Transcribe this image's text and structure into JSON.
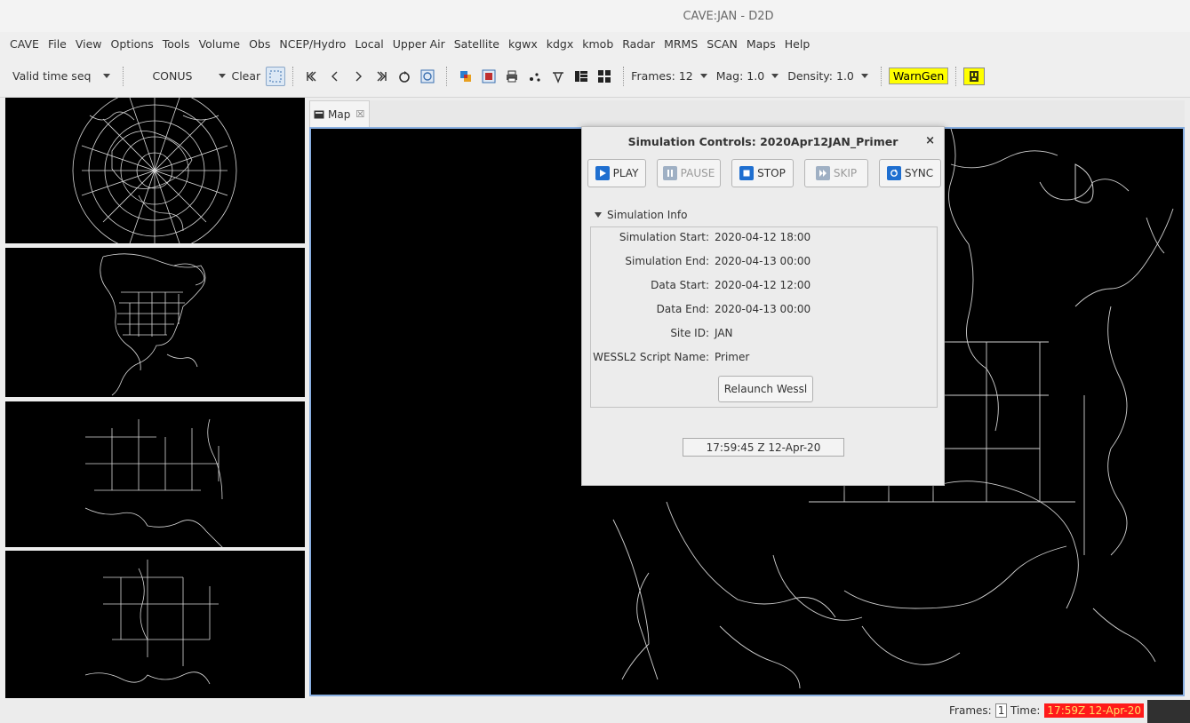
{
  "window": {
    "title": "CAVE:JAN - D2D"
  },
  "menu": [
    "CAVE",
    "File",
    "View",
    "Options",
    "Tools",
    "Volume",
    "Obs",
    "NCEP/Hydro",
    "Local",
    "Upper Air",
    "Satellite",
    "kgwx",
    "kdgx",
    "kmob",
    "Radar",
    "MRMS",
    "SCAN",
    "Maps",
    "Help"
  ],
  "toolbar": {
    "time_mode": "Valid time seq",
    "scale": "CONUS",
    "clear_label": "Clear",
    "frames": "Frames: 12",
    "mag": "Mag: 1.0",
    "density": "Density: 1.0",
    "warngen": "WarnGen"
  },
  "tabs": [
    {
      "label": "Map",
      "close": "☒"
    }
  ],
  "dialog": {
    "title": "Simulation Controls: 2020Apr12JAN_Primer",
    "close": "×",
    "buttons": {
      "play": "PLAY",
      "pause": "PAUSE",
      "stop": "STOP",
      "skip": "SKIP",
      "sync": "SYNC"
    },
    "section": "Simulation Info",
    "info": [
      {
        "label": "Simulation Start:",
        "value": "2020-04-12 18:00"
      },
      {
        "label": "Simulation End:",
        "value": "2020-04-13 00:00"
      },
      {
        "label": "Data Start:",
        "value": "2020-04-12 12:00"
      },
      {
        "label": "Data End:",
        "value": "2020-04-13 00:00"
      },
      {
        "label": "Site ID:",
        "value": "JAN"
      },
      {
        "label": "WESSL2 Script Name:",
        "value": "Primer"
      }
    ],
    "relaunch": "Relaunch Wessl",
    "clock": "17:59:45 Z 12-Apr-20"
  },
  "status": {
    "frames_label": "Frames:",
    "frames_value": "1",
    "time_label": "Time:",
    "time_value": "17:59Z 12-Apr-20"
  },
  "colors": {
    "accent_blue": "#1f6fd0",
    "warn_yellow": "#ffff00",
    "time_red": "#ff1a1a"
  }
}
